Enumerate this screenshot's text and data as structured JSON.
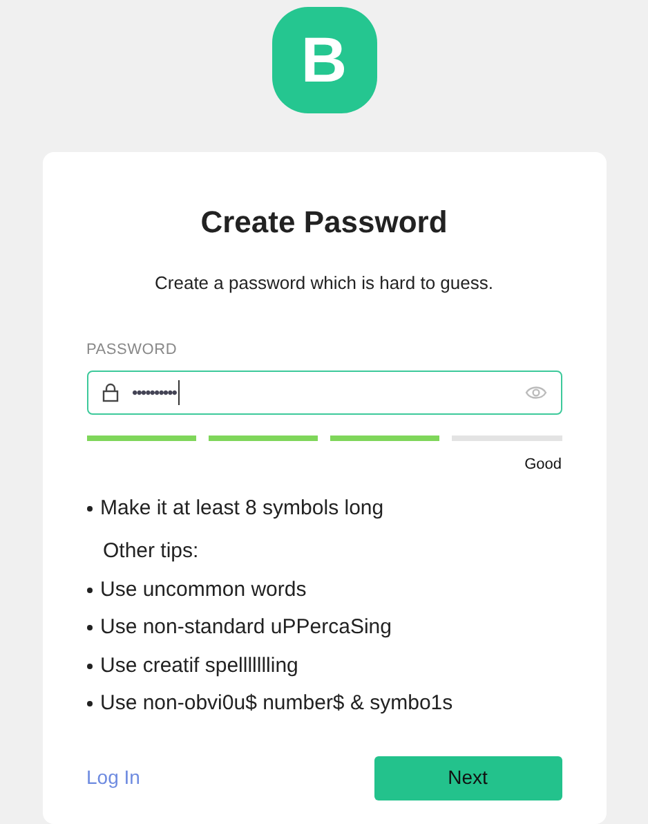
{
  "logo": {
    "letter": "B"
  },
  "title": "Create Password",
  "subtitle": "Create a password which is hard to guess.",
  "password": {
    "label": "PASSWORD",
    "value": "••••••••••",
    "focused": true
  },
  "strength": {
    "segments": [
      {
        "on": true
      },
      {
        "on": true
      },
      {
        "on": true
      },
      {
        "on": false
      }
    ],
    "label": "Good"
  },
  "rule": "Make it at least 8 symbols long",
  "tips_heading": "Other tips:",
  "tips": [
    "Use uncommon words",
    "Use non-standard uPPercaSing",
    "Use creatif spellllllling",
    "Use non-obvi0u$ number$ & symbo1s"
  ],
  "login_link": "Log In",
  "next_button": "Next"
}
